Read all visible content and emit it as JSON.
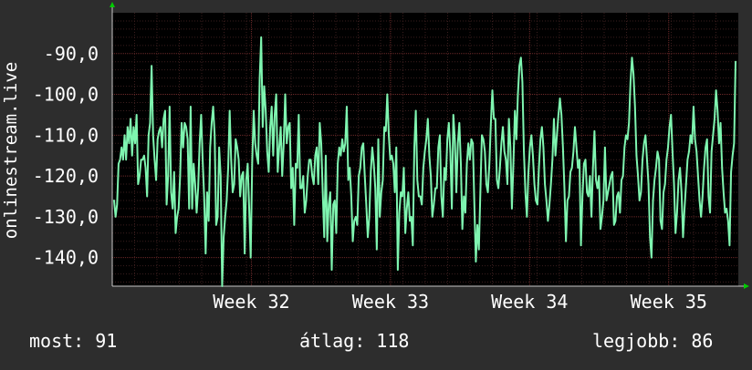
{
  "chart_data": {
    "type": "line",
    "ylabel": "onlinestream.live",
    "y_ticks": [
      "-90,0",
      "-100,0",
      "-110,0",
      "-120,0",
      "-130,0",
      "-140,0"
    ],
    "y_tick_values": [
      -90,
      -100,
      -110,
      -120,
      -130,
      -140
    ],
    "ylim": [
      -147,
      -80
    ],
    "x_tick_labels": [
      "Week 32",
      "Week 33",
      "Week 34",
      "Week 35"
    ],
    "x_tick_positions": [
      31,
      32,
      33,
      34
    ],
    "xlim": [
      30.0,
      34.5
    ],
    "grid": true,
    "line_color": "#7ff5b0",
    "grid_color": "#6e2a2a",
    "plot_background": "#000000",
    "series": [
      {
        "values": [
          -126,
          -130,
          -127,
          -117,
          -116,
          -113,
          -116,
          -110,
          -116,
          -108,
          -112,
          -106,
          -115,
          -108,
          -112,
          -105,
          -122,
          -120,
          -116,
          -116,
          -115,
          -118,
          -125,
          -110,
          -107,
          -93,
          -110,
          -116,
          -121,
          -111,
          -109,
          -108,
          -113,
          -106,
          -104,
          -127,
          -120,
          -103,
          -124,
          -128,
          -119,
          -134,
          -130,
          -128,
          -120,
          -107,
          -113,
          -107,
          -108,
          -111,
          -128,
          -103,
          -128,
          -117,
          -122,
          -129,
          -123,
          -112,
          -105,
          -116,
          -125,
          -139,
          -124,
          -131,
          -113,
          -107,
          -103,
          -110,
          -132,
          -130,
          -113,
          -120,
          -147,
          -135,
          -130,
          -126,
          -118,
          -104,
          -116,
          -124,
          -122,
          -111,
          -113,
          -116,
          -125,
          -120,
          -119,
          -139,
          -121,
          -117,
          -128,
          -140,
          -117,
          -104,
          -112,
          -115,
          -117,
          -96,
          -86,
          -108,
          -98,
          -104,
          -114,
          -119,
          -108,
          -103,
          -115,
          -105,
          -100,
          -119,
          -113,
          -108,
          -120,
          -112,
          -100,
          -112,
          -108,
          -107,
          -123,
          -118,
          -132,
          -117,
          -118,
          -105,
          -123,
          -123,
          -120,
          -129,
          -126,
          -120,
          -116,
          -116,
          -120,
          -122,
          -115,
          -113,
          -122,
          -107,
          -112,
          -124,
          -135,
          -115,
          -136,
          -127,
          -124,
          -143,
          -127,
          -126,
          -134,
          -117,
          -113,
          -115,
          -111,
          -114,
          -112,
          -103,
          -121,
          -118,
          -125,
          -136,
          -131,
          -130,
          -132,
          -120,
          -118,
          -113,
          -112,
          -120,
          -127,
          -135,
          -130,
          -119,
          -113,
          -117,
          -123,
          -138,
          -111,
          -130,
          -124,
          -121,
          -108,
          -109,
          -100,
          -110,
          -116,
          -115,
          -117,
          -124,
          -113,
          -143,
          -129,
          -124,
          -125,
          -118,
          -134,
          -128,
          -124,
          -131,
          -130,
          -137,
          -113,
          -104,
          -121,
          -125,
          -125,
          -127,
          -118,
          -114,
          -111,
          -106,
          -115,
          -120,
          -130,
          -127,
          -123,
          -123,
          -113,
          -110,
          -125,
          -130,
          -118,
          -121,
          -111,
          -107,
          -114,
          -128,
          -105,
          -111,
          -124,
          -112,
          -107,
          -117,
          -133,
          -125,
          -129,
          -117,
          -112,
          -116,
          -111,
          -112,
          -127,
          -141,
          -132,
          -138,
          -124,
          -110,
          -111,
          -114,
          -122,
          -124,
          -117,
          -107,
          -99,
          -106,
          -106,
          -121,
          -123,
          -118,
          -112,
          -108,
          -114,
          -116,
          -122,
          -106,
          -113,
          -128,
          -117,
          -104,
          -111,
          -100,
          -93,
          -91,
          -97,
          -114,
          -124,
          -130,
          -119,
          -113,
          -110,
          -115,
          -122,
          -126,
          -127,
          -118,
          -111,
          -108,
          -113,
          -122,
          -126,
          -131,
          -127,
          -122,
          -116,
          -106,
          -115,
          -110,
          -105,
          -101,
          -105,
          -113,
          -123,
          -136,
          -126,
          -125,
          -119,
          -118,
          -114,
          -108,
          -113,
          -118,
          -116,
          -137,
          -125,
          -117,
          -116,
          -124,
          -125,
          -120,
          -130,
          -118,
          -109,
          -121,
          -123,
          -120,
          -133,
          -130,
          -126,
          -113,
          -126,
          -124,
          -122,
          -120,
          -119,
          -132,
          -131,
          -125,
          -124,
          -129,
          -121,
          -120,
          -113,
          -110,
          -111,
          -107,
          -97,
          -91,
          -95,
          -103,
          -115,
          -120,
          -126,
          -124,
          -116,
          -112,
          -110,
          -116,
          -122,
          -135,
          -140,
          -126,
          -121,
          -118,
          -114,
          -116,
          -131,
          -133,
          -124,
          -122,
          -116,
          -113,
          -108,
          -105,
          -114,
          -122,
          -134,
          -129,
          -121,
          -118,
          -124,
          -135,
          -128,
          -122,
          -116,
          -114,
          -110,
          -112,
          -103,
          -111,
          -114,
          -120,
          -126,
          -130,
          -125,
          -118,
          -113,
          -111,
          -125,
          -129,
          -114,
          -110,
          -106,
          -99,
          -104,
          -112,
          -107,
          -118,
          -124,
          -129,
          -128,
          -131,
          -137,
          -119,
          -115,
          -112,
          -92
        ]
      }
    ]
  },
  "footer": {
    "now": "most: 91",
    "avg": "átlag: 118",
    "best": "legjobb: 86"
  }
}
